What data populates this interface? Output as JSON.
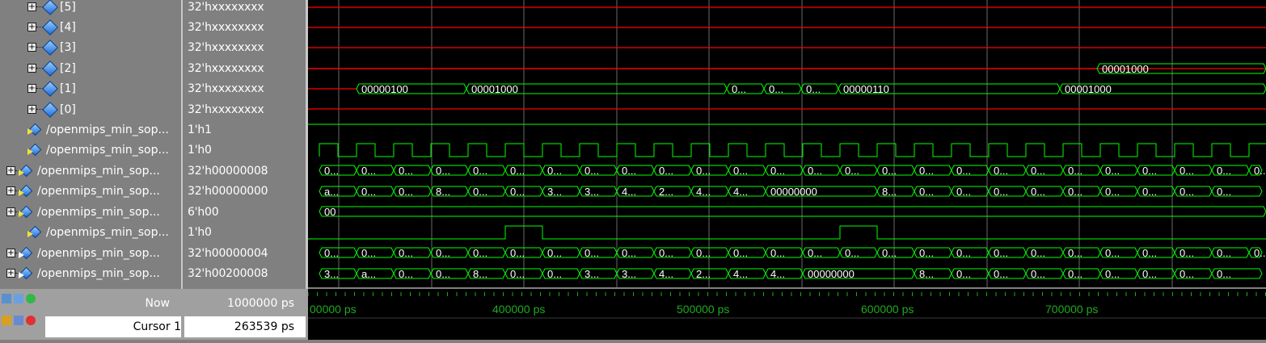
{
  "signals": [
    {
      "label": "[5]",
      "value": "32'hxxxxxxxx",
      "kind": "sub"
    },
    {
      "label": "[4]",
      "value": "32'hxxxxxxxx",
      "kind": "sub"
    },
    {
      "label": "[3]",
      "value": "32'hxxxxxxxx",
      "kind": "sub"
    },
    {
      "label": "[2]",
      "value": "32'hxxxxxxxx",
      "kind": "sub"
    },
    {
      "label": "[1]",
      "value": "32'hxxxxxxxx",
      "kind": "sub"
    },
    {
      "label": "[0]",
      "value": "32'hxxxxxxxx",
      "kind": "sub"
    },
    {
      "label": "/openmips_min_sop...",
      "value": "1'h1",
      "kind": "bit"
    },
    {
      "label": "/openmips_min_sop...",
      "value": "1'h0",
      "kind": "bit"
    },
    {
      "label": "/openmips_min_sop...",
      "value": "32'h00000008",
      "kind": "bus"
    },
    {
      "label": "/openmips_min_sop...",
      "value": "32'h00000000",
      "kind": "bus"
    },
    {
      "label": "/openmips_min_sop...",
      "value": "6'h00",
      "kind": "bus"
    },
    {
      "label": "/openmips_min_sop...",
      "value": "1'h0",
      "kind": "bit"
    },
    {
      "label": "/openmips_min_sop...",
      "value": "32'h00000004",
      "kind": "bus"
    },
    {
      "label": "/openmips_min_sop...",
      "value": "32'h00200008",
      "kind": "bus"
    }
  ],
  "wave_texts": {
    "r2": "00001000",
    "r1a": "00000100",
    "r1b": "00001000",
    "r1c": "0...",
    "r1d": "0...",
    "r1e": "0...",
    "r1f": "00000110",
    "r1g": "00001000",
    "r8": [
      "0...",
      "0...",
      "0...",
      "0...",
      "0...",
      "0...",
      "0...",
      "0...",
      "0...",
      "0...",
      "0...",
      "0...",
      "0...",
      "0...",
      "0...",
      "0...",
      "0...",
      "0...",
      "0...",
      "0...",
      "0...",
      "0...",
      "0...",
      "0...",
      "0...",
      "0...",
      "0..."
    ],
    "r9": [
      "a...",
      "0...",
      "0...",
      "8...",
      "0...",
      "0...",
      "3...",
      "3...",
      "4...",
      "2...",
      "4...",
      "4...",
      "00000000",
      "8...",
      "0...",
      "0...",
      "0...",
      "0...",
      "0...",
      "0...",
      "0...",
      "0...",
      "0...",
      "0...",
      "0..."
    ],
    "r10": "00",
    "r12": [
      "0...",
      "0...",
      "0...",
      "0...",
      "0...",
      "0...",
      "0...",
      "0...",
      "0...",
      "0...",
      "0...",
      "0...",
      "0...",
      "0...",
      "0...",
      "0...",
      "0...",
      "0...",
      "0...",
      "0...",
      "0...",
      "0...",
      "0...",
      "0...",
      "0...",
      "0...",
      "0..."
    ],
    "r13": [
      "3...",
      "a...",
      "0...",
      "0...",
      "8...",
      "0...",
      "0...",
      "3...",
      "3...",
      "4...",
      "2...",
      "4...",
      "4...",
      "00000000",
      "8...",
      "0...",
      "0...",
      "0...",
      "0...",
      "0...",
      "0...",
      "0...",
      "0...",
      "0...",
      "0..."
    ]
  },
  "footer": {
    "now_label": "Now",
    "now_value": "1000000 ps",
    "cursor_label": "Cursor 1",
    "cursor_value": "263539 ps"
  },
  "timeline": [
    "00000 ps",
    "400000 ps",
    "500000 ps",
    "600000 ps",
    "700000 ps"
  ],
  "colors": {
    "wave": "#00ff00",
    "undefined": "#ff0000",
    "grid": "#6a6a6a",
    "timeline_text": "#1faa1f"
  }
}
